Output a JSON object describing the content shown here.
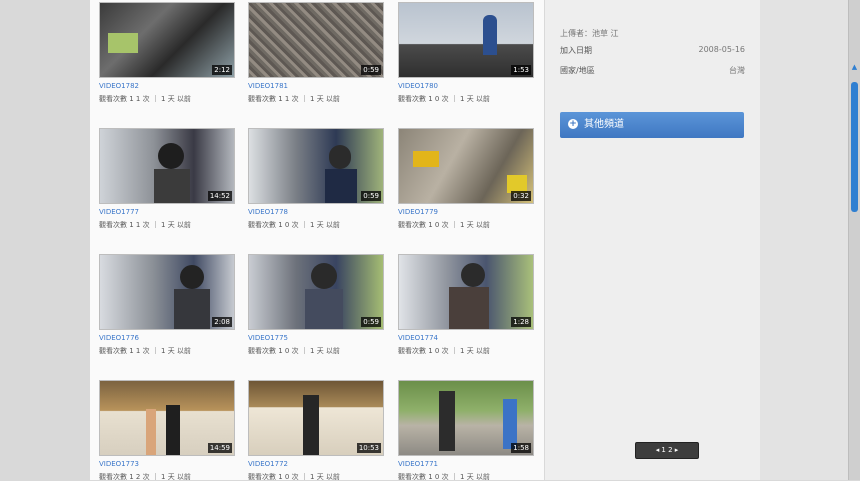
{
  "videos": [
    {
      "title": "VIDEO1782",
      "meta": "觀看次數 1 1 次 ｜ 1 天 以前",
      "duration": "2:12"
    },
    {
      "title": "VIDEO1781",
      "meta": "觀看次數 1 1 次 ｜ 1 天 以前",
      "duration": "0:59"
    },
    {
      "title": "VIDEO1780",
      "meta": "觀看次數 1 0 次 ｜ 1 天 以前",
      "duration": "1:53"
    },
    {
      "title": "VIDEO1777",
      "meta": "觀看次數 1 1 次 ｜ 1 天 以前",
      "duration": "14:52"
    },
    {
      "title": "VIDEO1778",
      "meta": "觀看次數 1 0 次 ｜ 1 天 以前",
      "duration": "0:59"
    },
    {
      "title": "VIDEO1779",
      "meta": "觀看次數 1 0 次 ｜ 1 天 以前",
      "duration": "0:32"
    },
    {
      "title": "VIDEO1776",
      "meta": "觀看次數 1 1 次 ｜ 1 天 以前",
      "duration": "2:08"
    },
    {
      "title": "VIDEO1775",
      "meta": "觀看次數 1 0 次 ｜ 1 天 以前",
      "duration": "0:59"
    },
    {
      "title": "VIDEO1774",
      "meta": "觀看次數 1 0 次 ｜ 1 天 以前",
      "duration": "1:28"
    },
    {
      "title": "VIDEO1773",
      "meta": "觀看次數 1 2 次 ｜ 1 天 以前",
      "duration": "14:59"
    },
    {
      "title": "VIDEO1772",
      "meta": "觀看次數 1 0 次 ｜ 1 天 以前",
      "duration": "10:53"
    },
    {
      "title": "VIDEO1771",
      "meta": "觀看次數 1 0 次 ｜ 1 天 以前",
      "duration": "1:58"
    }
  ],
  "sidebar": {
    "uploader": "上傳者：池草 江",
    "join_label": "加入日期",
    "join_value": "2008-05-16",
    "country_label": "國家/地區",
    "country_value": "台灣",
    "other_channels": "其他頻道"
  },
  "pager": {
    "label": "◂ 1 2 ▸"
  },
  "colors": {
    "link": "#3a76c9",
    "accent": "#3f77c2",
    "scroll": "#2f7fd1"
  }
}
